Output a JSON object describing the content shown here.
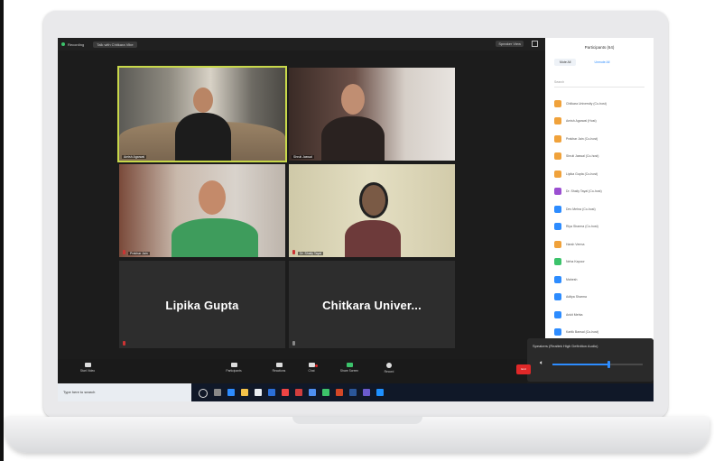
{
  "window": {
    "title": "Recording",
    "view_selector": "Talk with Chitkara Vibe",
    "speaker_view_label": "Speaker View"
  },
  "tiles": [
    {
      "name": "Amish Agarwal",
      "active": true
    },
    {
      "name": "Shruti Jaswal"
    },
    {
      "name": "Prakhar Jain"
    },
    {
      "name": "Dr. Shaily Tayal"
    },
    {
      "name": "Lipika Gupta",
      "display_name": "Lipika Gupta"
    },
    {
      "name": "Chitkara Univer...",
      "display_name": "Chitkara Univer..."
    }
  ],
  "participants": {
    "title": "Participants (64)",
    "tabs": [
      "Mute All",
      "Unmute All"
    ],
    "search_placeholder": "Search",
    "items": [
      {
        "name": "Chitkara University (Co-host)",
        "color": "#f0a23b"
      },
      {
        "name": "Amish Agarwal (Host)",
        "color": "#f0a23b"
      },
      {
        "name": "Prakhar Jain (Co-host)",
        "color": "#f0a23b"
      },
      {
        "name": "Shruti Jaswal (Co-host)",
        "color": "#f0a23b"
      },
      {
        "name": "Lipika Gupta (Co-host)",
        "color": "#f0a23b"
      },
      {
        "name": "Dr. Shaily Tayal (Co-host)",
        "color": "#9b4fd1"
      },
      {
        "name": "Dev Mehra (Co-host)",
        "color": "#2d8cff"
      },
      {
        "name": "Riya Sharma (Co-host)",
        "color": "#2d8cff"
      },
      {
        "name": "Harsh Verma",
        "color": "#f0a23b"
      },
      {
        "name": "Neha Kapoor",
        "color": "#3cc36b"
      },
      {
        "name": "Mahesh",
        "color": "#2d8cff"
      },
      {
        "name": "Aditya Sharma",
        "color": "#2d8cff"
      },
      {
        "name": "Ankit Mehta",
        "color": "#2d8cff"
      },
      {
        "name": "Kartik Bansal (Co-host)",
        "color": "#2d8cff"
      }
    ]
  },
  "audio": {
    "device_label": "Speakers (Realtek High Definition Audio)",
    "volume": 0.62
  },
  "toolbar": {
    "video_label": "Start Video",
    "participants_label": "Participants",
    "participants_count": "64",
    "reactions_label": "Reactions",
    "chat_label": "Chat",
    "share_label": "Share Screen",
    "record_label": "Record",
    "leave_label": "End"
  },
  "taskbar": {
    "search_placeholder": "Type here to search",
    "tray_time": "",
    "tray_date": ""
  }
}
